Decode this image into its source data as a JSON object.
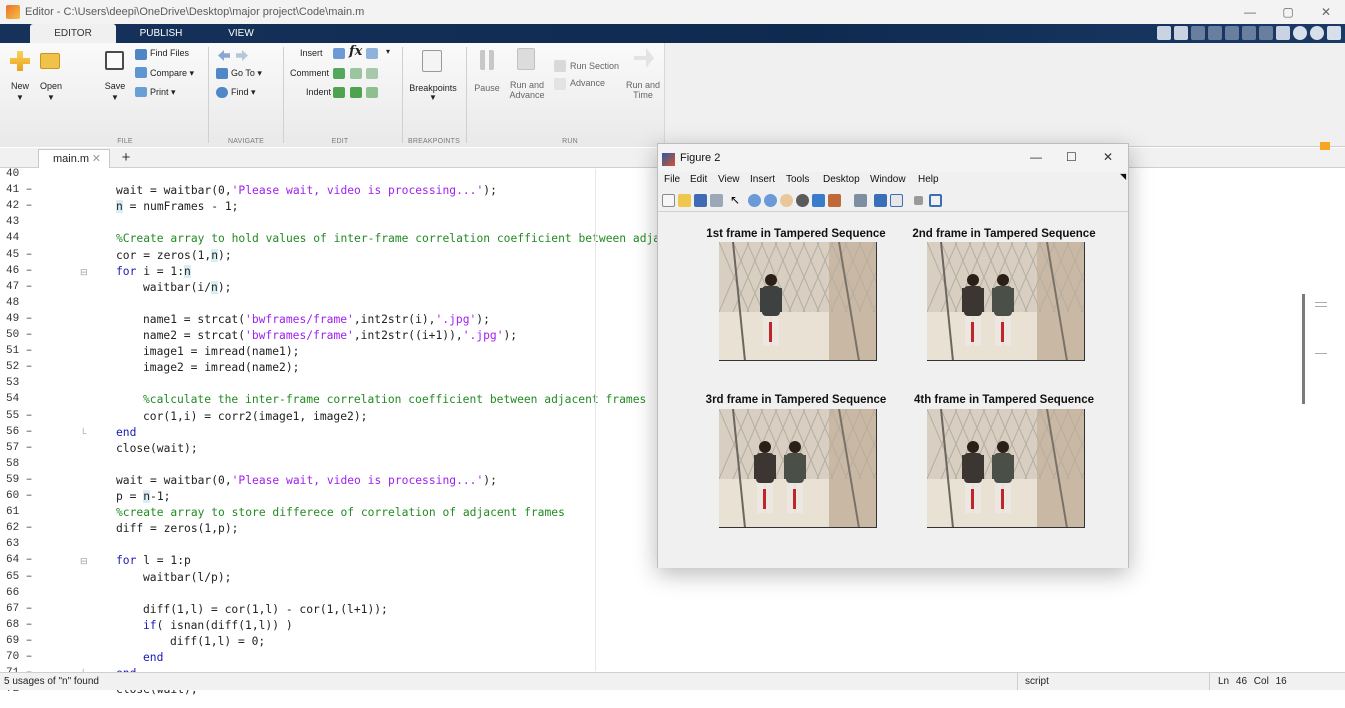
{
  "window": {
    "title": "Editor - C:\\Users\\deepi\\OneDrive\\Desktop\\major project\\Code\\main.m",
    "controls": [
      "—",
      "▢",
      "✕"
    ]
  },
  "ribbon_tabs": [
    "EDITOR",
    "PUBLISH",
    "VIEW"
  ],
  "ribbon": {
    "file": {
      "new": "New",
      "open": "Open",
      "save": "Save",
      "find_files": "Find Files",
      "compare": "Compare",
      "print": "Print",
      "group": "FILE"
    },
    "navigate": {
      "go_to": "Go To",
      "find": "Find",
      "group": "NAVIGATE"
    },
    "edit": {
      "insert": "Insert",
      "comment": "Comment",
      "indent": "Indent",
      "group": "EDIT"
    },
    "breakpoints": {
      "label": "Breakpoints",
      "group": "BREAKPOINTS"
    },
    "run": {
      "pause": "Pause",
      "run_and_advance": "Run and Advance",
      "run_section": "Run Section",
      "advance": "Advance",
      "run_and_time": "Run and Time",
      "group": "RUN"
    }
  },
  "file_tab": {
    "name": "main.m",
    "close": "✕",
    "add": "+"
  },
  "editor": {
    "lines": [
      {
        "num": "40",
        "dash": false,
        "fold": "",
        "indent": 0,
        "parts": []
      },
      {
        "num": "41",
        "dash": true,
        "fold": "",
        "indent": 0,
        "parts": [
          {
            "t": "wait = waitbar(0,",
            "c": ""
          },
          {
            "t": "'Please wait, video is processing...'",
            "c": "str"
          },
          {
            "t": ");",
            "c": ""
          }
        ]
      },
      {
        "num": "42",
        "dash": true,
        "fold": "",
        "indent": 0,
        "parts": [
          {
            "t": "n",
            "c": "hl"
          },
          {
            "t": " = numFrames - 1;",
            "c": ""
          }
        ]
      },
      {
        "num": "43",
        "dash": false,
        "fold": "",
        "indent": 0,
        "parts": []
      },
      {
        "num": "44",
        "dash": false,
        "fold": "",
        "indent": 0,
        "parts": [
          {
            "t": "%Create array to hold values of inter-frame correlation coefficient between adjacent frames",
            "c": "cm"
          }
        ]
      },
      {
        "num": "45",
        "dash": true,
        "fold": "",
        "indent": 0,
        "parts": [
          {
            "t": "cor = zeros(1,",
            "c": ""
          },
          {
            "t": "n",
            "c": "hl"
          },
          {
            "t": ");",
            "c": ""
          }
        ]
      },
      {
        "num": "46",
        "dash": true,
        "fold": "⊟",
        "indent": 0,
        "parts": [
          {
            "t": "for",
            "c": "kw"
          },
          {
            "t": " i = 1:",
            "c": ""
          },
          {
            "t": "n",
            "c": "hl"
          }
        ]
      },
      {
        "num": "47",
        "dash": true,
        "fold": "",
        "indent": 1,
        "parts": [
          {
            "t": "waitbar(i/",
            "c": ""
          },
          {
            "t": "n",
            "c": "hl"
          },
          {
            "t": ");",
            "c": ""
          }
        ]
      },
      {
        "num": "48",
        "dash": false,
        "fold": "",
        "indent": 0,
        "parts": []
      },
      {
        "num": "49",
        "dash": true,
        "fold": "",
        "indent": 1,
        "parts": [
          {
            "t": "name1 = strcat(",
            "c": ""
          },
          {
            "t": "'bwframes/frame'",
            "c": "str"
          },
          {
            "t": ",int2str(i),",
            "c": ""
          },
          {
            "t": "'.jpg'",
            "c": "str"
          },
          {
            "t": ");",
            "c": ""
          }
        ]
      },
      {
        "num": "50",
        "dash": true,
        "fold": "",
        "indent": 1,
        "parts": [
          {
            "t": "name2 = strcat(",
            "c": ""
          },
          {
            "t": "'bwframes/frame'",
            "c": "str"
          },
          {
            "t": ",int2str((i+1)),",
            "c": ""
          },
          {
            "t": "'.jpg'",
            "c": "str"
          },
          {
            "t": ");",
            "c": ""
          }
        ]
      },
      {
        "num": "51",
        "dash": true,
        "fold": "",
        "indent": 1,
        "parts": [
          {
            "t": "image1 = imread(name1);",
            "c": ""
          }
        ]
      },
      {
        "num": "52",
        "dash": true,
        "fold": "",
        "indent": 1,
        "parts": [
          {
            "t": "image2 = imread(name2);",
            "c": ""
          }
        ]
      },
      {
        "num": "53",
        "dash": false,
        "fold": "",
        "indent": 0,
        "parts": []
      },
      {
        "num": "54",
        "dash": false,
        "fold": "",
        "indent": 1,
        "parts": [
          {
            "t": "%calculate the inter-frame correlation coefficient between adjacent frames",
            "c": "cm"
          }
        ]
      },
      {
        "num": "55",
        "dash": true,
        "fold": "",
        "indent": 1,
        "parts": [
          {
            "t": "cor(1,i) = corr2(image1, image2);",
            "c": ""
          }
        ]
      },
      {
        "num": "56",
        "dash": true,
        "fold": "└",
        "indent": 0,
        "parts": [
          {
            "t": "end",
            "c": "kw"
          }
        ]
      },
      {
        "num": "57",
        "dash": true,
        "fold": "",
        "indent": 0,
        "parts": [
          {
            "t": "close(wait);",
            "c": ""
          }
        ]
      },
      {
        "num": "58",
        "dash": false,
        "fold": "",
        "indent": 0,
        "parts": []
      },
      {
        "num": "59",
        "dash": true,
        "fold": "",
        "indent": 0,
        "parts": [
          {
            "t": "wait = waitbar(0,",
            "c": ""
          },
          {
            "t": "'Please wait, video is processing...'",
            "c": "str"
          },
          {
            "t": ");",
            "c": ""
          }
        ]
      },
      {
        "num": "60",
        "dash": true,
        "fold": "",
        "indent": 0,
        "parts": [
          {
            "t": "p = ",
            "c": ""
          },
          {
            "t": "n",
            "c": "hl"
          },
          {
            "t": "-1;",
            "c": ""
          }
        ]
      },
      {
        "num": "61",
        "dash": false,
        "fold": "",
        "indent": 0,
        "parts": [
          {
            "t": "%create array to store differece of correlation of adjacent frames",
            "c": "cm"
          }
        ]
      },
      {
        "num": "62",
        "dash": true,
        "fold": "",
        "indent": 0,
        "parts": [
          {
            "t": "diff = zeros(1,p);",
            "c": ""
          }
        ]
      },
      {
        "num": "63",
        "dash": false,
        "fold": "",
        "indent": 0,
        "parts": []
      },
      {
        "num": "64",
        "dash": true,
        "fold": "⊟",
        "indent": 0,
        "parts": [
          {
            "t": "for",
            "c": "kw"
          },
          {
            "t": " l = 1:p",
            "c": ""
          }
        ]
      },
      {
        "num": "65",
        "dash": true,
        "fold": "",
        "indent": 1,
        "parts": [
          {
            "t": "waitbar(l/p);",
            "c": ""
          }
        ]
      },
      {
        "num": "66",
        "dash": false,
        "fold": "",
        "indent": 0,
        "parts": []
      },
      {
        "num": "67",
        "dash": true,
        "fold": "",
        "indent": 1,
        "parts": [
          {
            "t": "diff(1,l) = cor(1,l) - cor(1,(l+1));",
            "c": ""
          }
        ]
      },
      {
        "num": "68",
        "dash": true,
        "fold": "",
        "indent": 1,
        "parts": [
          {
            "t": "if",
            "c": "kw"
          },
          {
            "t": "( isnan(diff(1,l)) )",
            "c": ""
          }
        ]
      },
      {
        "num": "69",
        "dash": true,
        "fold": "",
        "indent": 2,
        "parts": [
          {
            "t": "diff(1,l) = 0;",
            "c": ""
          }
        ]
      },
      {
        "num": "70",
        "dash": true,
        "fold": "",
        "indent": 1,
        "parts": [
          {
            "t": "end",
            "c": "kw"
          }
        ]
      },
      {
        "num": "71",
        "dash": true,
        "fold": "└",
        "indent": 0,
        "parts": [
          {
            "t": "end",
            "c": "kw"
          }
        ]
      },
      {
        "num": "72",
        "dash": true,
        "fold": "",
        "indent": 0,
        "parts": [
          {
            "t": "close(wait);",
            "c": ""
          }
        ]
      }
    ]
  },
  "status": {
    "message": "5 usages of \"n\" found",
    "mode": "script",
    "position": "Ln 46  Col 16"
  },
  "figure": {
    "title": "Figure 2",
    "menu": [
      "File",
      "Edit",
      "View",
      "Insert",
      "Tools",
      "Desktop",
      "Window",
      "Help"
    ],
    "panels": [
      {
        "title": "1st frame in Tampered Sequence",
        "people": 1
      },
      {
        "title": "2nd frame in Tampered Sequence",
        "people": 2
      },
      {
        "title": "3rd frame in Tampered Sequence",
        "people": 2
      },
      {
        "title": "4th frame in Tampered Sequence",
        "people": 2
      }
    ]
  }
}
